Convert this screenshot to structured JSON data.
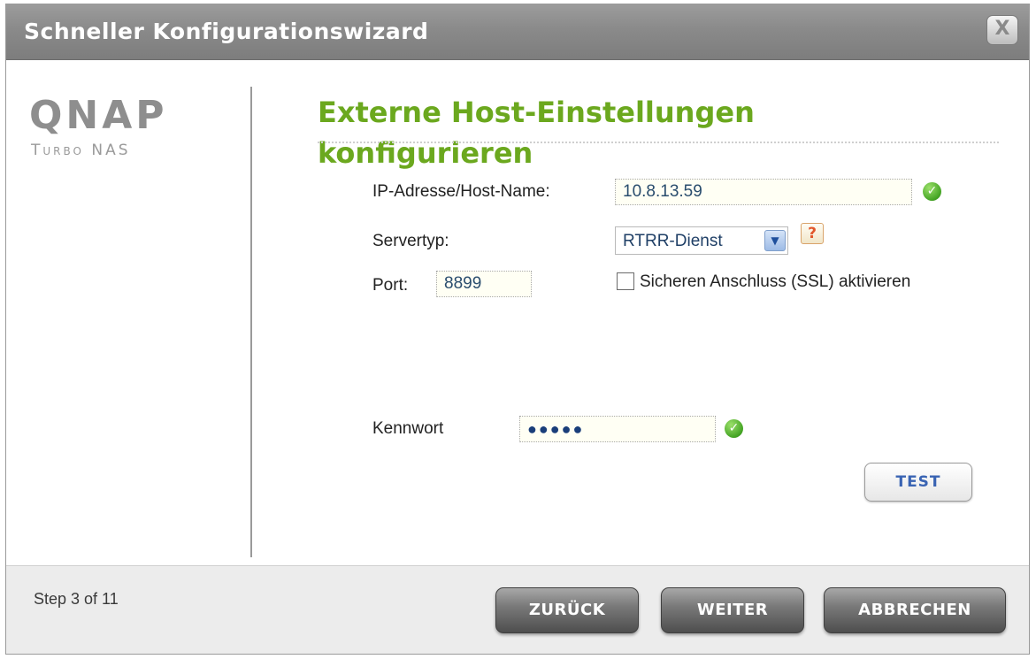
{
  "window": {
    "title": "Schneller Konfigurationswizard",
    "close_label": "X"
  },
  "brand": {
    "logo": "QNAP",
    "subtitle": "Turbo NAS"
  },
  "page": {
    "heading_line1": "Externe Host-Einstellungen",
    "heading_line2": "konfigurieren"
  },
  "form": {
    "host": {
      "label": "IP-Adresse/Host-Name:",
      "value": "10.8.13.59",
      "valid_icon": "check-circle-icon"
    },
    "server_type": {
      "label": "Servertyp:",
      "selected": "RTRR-Dienst",
      "arrow_icon": "chevron-down-icon",
      "help": "?"
    },
    "port": {
      "label": "Port:",
      "value": "8899"
    },
    "ssl": {
      "label": "Sicheren Anschluss (SSL) aktivieren",
      "checked": false
    },
    "password": {
      "label": "Kennwort",
      "value": "●●●●●",
      "valid_icon": "check-circle-icon"
    },
    "test_label": "TEST"
  },
  "footer": {
    "step": "Step 3 of 11",
    "back_label": "ZURÜCK",
    "next_label": "WEITER",
    "cancel_label": "ABBRECHEN"
  },
  "colors": {
    "heading_green": "#6ba81e",
    "titlebar_gray": "#8a8a8a",
    "valid_green": "#44a424",
    "help_orange": "#e2562b",
    "test_blue": "#3a64b3"
  }
}
